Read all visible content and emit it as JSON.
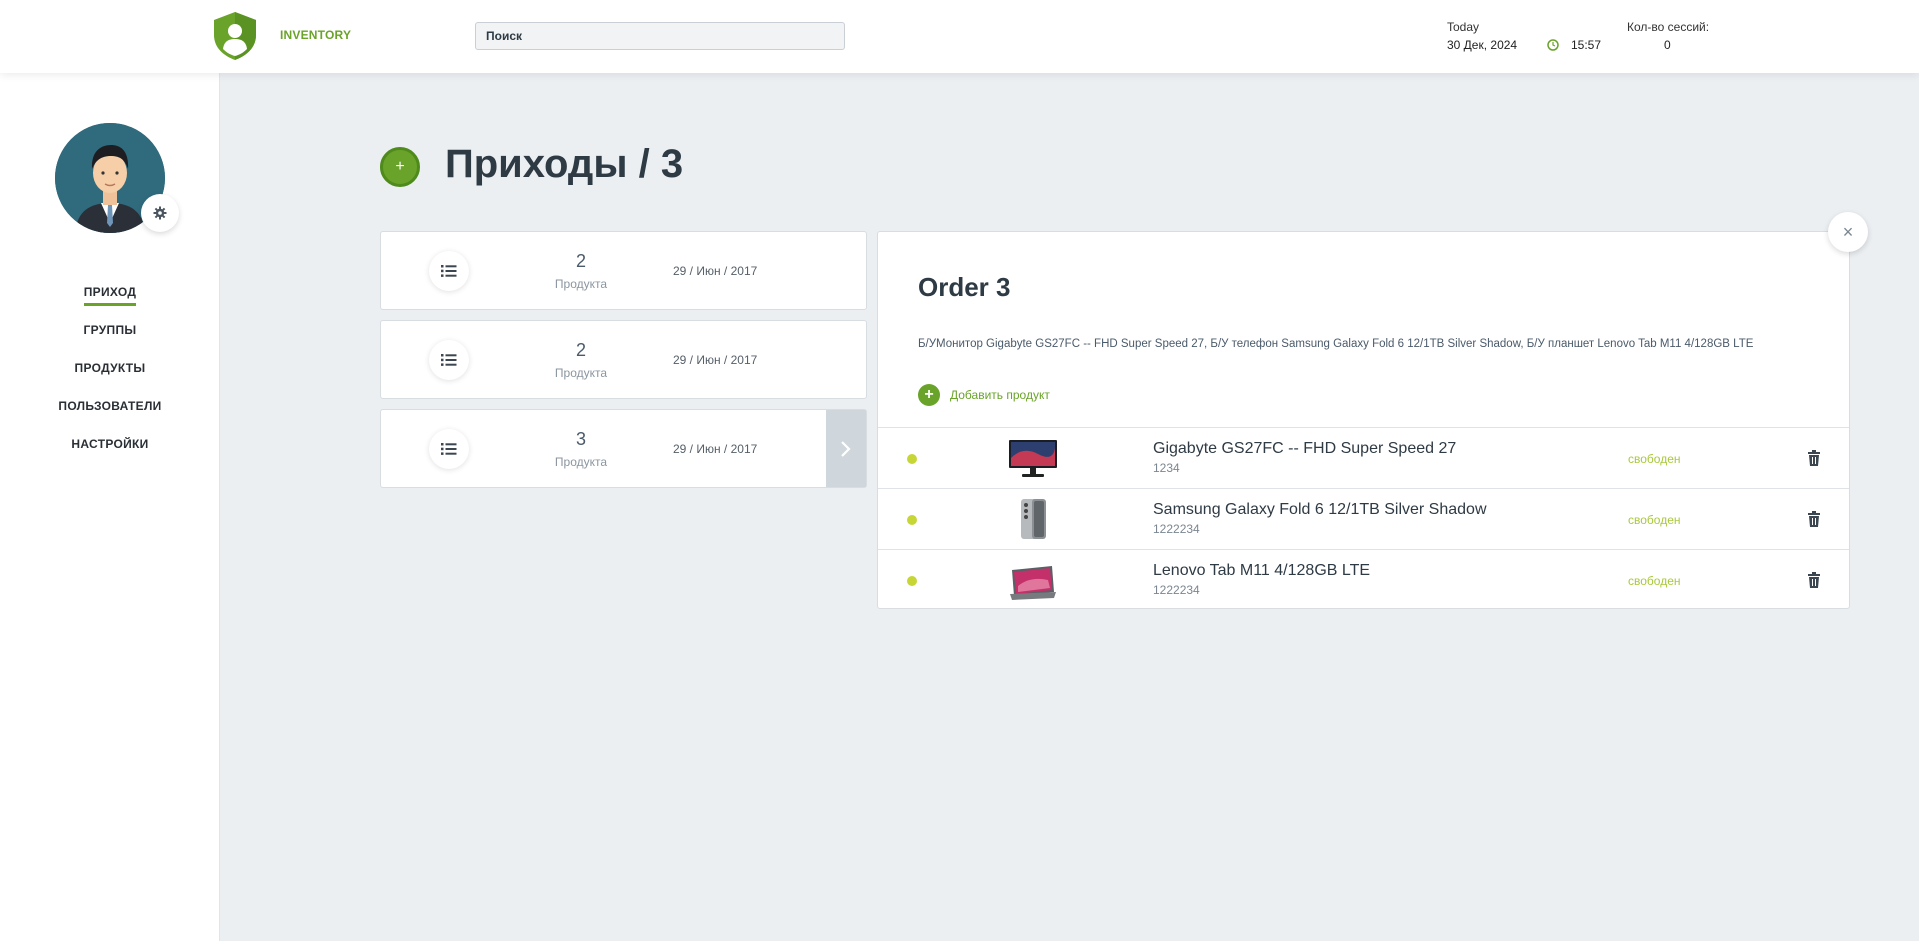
{
  "header": {
    "brand": "INVENTORY",
    "search_placeholder": "Поиск",
    "today_label": "Today",
    "today_date": "30 Дек, 2024",
    "time": "15:57",
    "sessions_label": "Кол-во сессий:",
    "sessions_value": "0"
  },
  "sidebar": {
    "nav": [
      {
        "label": "ПРИХОД",
        "active": true
      },
      {
        "label": "ГРУППЫ"
      },
      {
        "label": "ПРОДУКТЫ"
      },
      {
        "label": "ПОЛЬЗОВАТЕЛИ"
      },
      {
        "label": "НАСТРОЙКИ"
      }
    ]
  },
  "main": {
    "add_icon": "+",
    "title": "Приходы / 3",
    "orders": [
      {
        "count": "2",
        "count_label": "Продукта",
        "date": "29 / Июн / 2017"
      },
      {
        "count": "2",
        "count_label": "Продукта",
        "date": "29 / Июн / 2017"
      },
      {
        "count": "3",
        "count_label": "Продукта",
        "date": "29 / Июн / 2017",
        "selected": true
      }
    ]
  },
  "detail": {
    "close_icon": "×",
    "title": "Order 3",
    "description": "Б/УМонитор Gigabyte GS27FC -- FHD Super Speed 27, Б/У телефон Samsung Galaxy Fold 6 12/1TB Silver Shadow, Б/У планшет Lenovo Tab M11 4/128GB LTE",
    "add_product_label": "Добавить продукт",
    "items": [
      {
        "name": "Gigabyte GS27FC -- FHD Super Speed 27",
        "code": "1234",
        "status": "свободен",
        "thumb": "monitor"
      },
      {
        "name": "Samsung Galaxy Fold 6 12/1TB Silver Shadow",
        "code": "1222234",
        "status": "свободен",
        "thumb": "phone"
      },
      {
        "name": "Lenovo Tab M11 4/128GB LTE",
        "code": "1222234",
        "status": "свободен",
        "thumb": "tablet"
      }
    ]
  },
  "colors": {
    "accent": "#6aa329",
    "status_dot": "#c6d636",
    "status_text": "#a9c93b",
    "sidebar_avatar_bg": "#2f6b7d"
  }
}
